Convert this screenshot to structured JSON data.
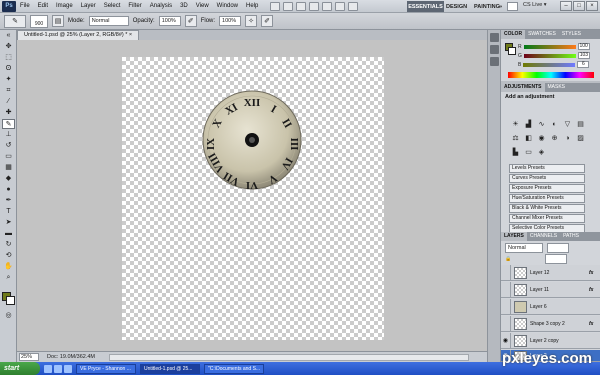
{
  "menubar": {
    "logo": "Ps",
    "items": [
      "File",
      "Edit",
      "Image",
      "Layer",
      "Select",
      "Filter",
      "Analysis",
      "3D",
      "View",
      "Window",
      "Help"
    ],
    "workspaces": [
      "ESSENTIALS",
      "DESIGN",
      "PAINTING",
      "»"
    ],
    "cs_live": "CS Live ▾",
    "window_buttons": [
      "–",
      "□",
      "×"
    ]
  },
  "options": {
    "brush_size": "900",
    "mode_label": "Mode:",
    "mode_value": "Normal",
    "opacity_label": "Opacity:",
    "opacity_value": "100%",
    "flow_label": "Flow:",
    "flow_value": "100%"
  },
  "document": {
    "tab_title": "Untitled-1.psd @ 25% (Layer 2, RGB/8#) *  ×"
  },
  "status": {
    "zoom": "25%",
    "doc_size": "Doc: 19.0M/362.4M"
  },
  "panels": {
    "color_tabs": [
      "COLOR",
      "SWATCHES",
      "STYLES"
    ],
    "color_values": {
      "r": "100",
      "g": "103",
      "b": "6"
    },
    "color_hex": {
      "fg": "#6f7a19",
      "bg": "#ffffff"
    },
    "adj_tabs": [
      "ADJUSTMENTS",
      "MASKS"
    ],
    "adj_title": "Add an adjustment",
    "presets": [
      "Levels Presets",
      "Curves Presets",
      "Exposure Presets",
      "Hue/Saturation Presets",
      "Black & White Presets",
      "Channel Mixer Presets",
      "Selective Color Presets"
    ],
    "layer_tabs": [
      "LAYERS",
      "CHANNELS",
      "PATHS"
    ],
    "blend_mode": "Normal",
    "layers": [
      {
        "name": "Layer 12",
        "fx": "fx",
        "selected": false
      },
      {
        "name": "Layer 11",
        "fx": "fx",
        "selected": false
      },
      {
        "name": "Layer 6",
        "fx": "",
        "selected": false
      },
      {
        "name": "Shape 3 copy 2",
        "fx": "fx",
        "selected": false
      },
      {
        "name": "Layer 2 copy",
        "fx": "",
        "selected": false
      },
      {
        "name": "Layer 2",
        "fx": "",
        "selected": true
      }
    ]
  },
  "taskbar": {
    "start": "start",
    "tasks": [
      "VE Pryce - Shannon ...",
      "Untitled-1.psd @ 25...",
      "\"C:\\Documents and S..."
    ]
  },
  "watermark": "pxleyes.com"
}
